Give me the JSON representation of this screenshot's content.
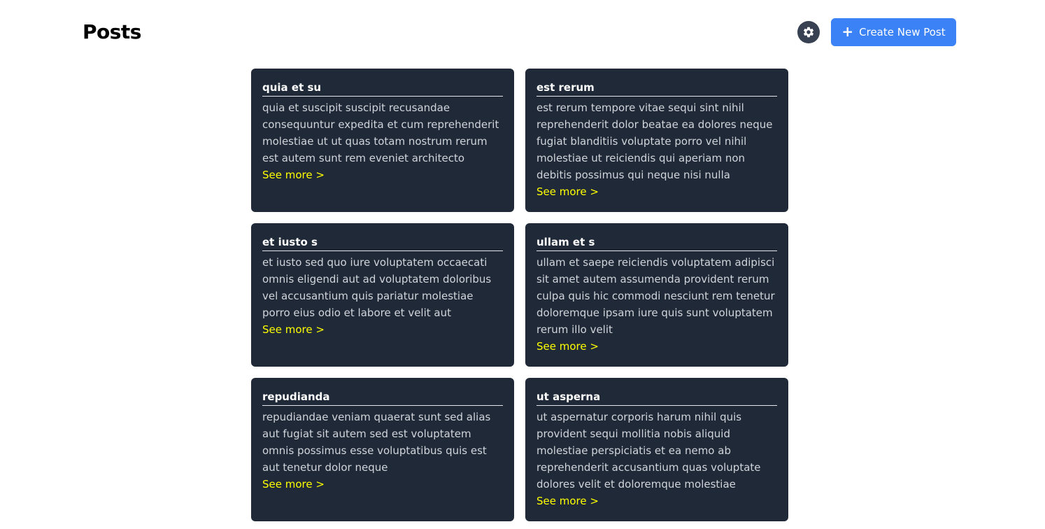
{
  "header": {
    "title": "Posts",
    "theme_toggle_icon": "gear-icon",
    "create_button": {
      "icon": "plus-icon",
      "label": "Create New Post"
    }
  },
  "colors": {
    "accent": "#3b82f6",
    "card_background": "#1f2937",
    "link": "#ffff00",
    "title_text": "#000000"
  },
  "posts": [
    {
      "title": "quia et su",
      "body": "quia et suscipit suscipit recusandae consequuntur expedita et cum reprehenderit molestiae ut ut quas totam nostrum rerum est autem sunt rem eveniet architecto",
      "link": "See more >"
    },
    {
      "title": "est rerum",
      "body": "est rerum tempore vitae sequi sint nihil reprehenderit dolor beatae ea dolores neque fugiat blanditiis voluptate porro vel nihil molestiae ut reiciendis qui aperiam non debitis possimus qui neque nisi nulla",
      "link": "See more >"
    },
    {
      "title": "et iusto s",
      "body": "et iusto sed quo iure voluptatem occaecati omnis eligendi aut ad voluptatem doloribus vel accusantium quis pariatur molestiae porro eius odio et labore et velit aut",
      "link": "See more >"
    },
    {
      "title": "ullam et s",
      "body": "ullam et saepe reiciendis voluptatem adipisci sit amet autem assumenda provident rerum culpa quis hic commodi nesciunt rem tenetur doloremque ipsam iure quis sunt voluptatem rerum illo velit",
      "link": "See more >"
    },
    {
      "title": "repudianda",
      "body": "repudiandae veniam quaerat sunt sed alias aut fugiat sit autem sed est voluptatem omnis possimus esse voluptatibus quis est aut tenetur dolor neque",
      "link": "See more >"
    },
    {
      "title": "ut asperna",
      "body": "ut aspernatur corporis harum nihil quis provident sequi mollitia nobis aliquid molestiae perspiciatis et ea nemo ab reprehenderit accusantium quas voluptate dolores velit et doloremque molestiae",
      "link": "See more >"
    }
  ]
}
